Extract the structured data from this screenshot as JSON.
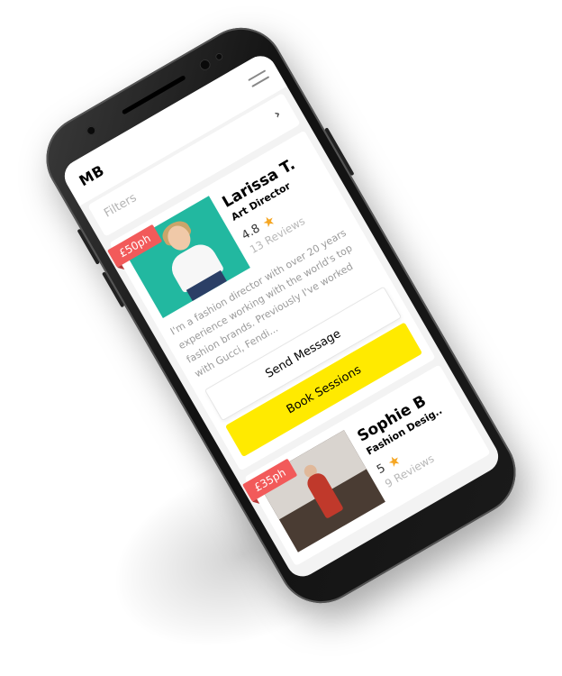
{
  "app": {
    "logo": "MB"
  },
  "filters": {
    "label": "Filters"
  },
  "cards": [
    {
      "price": "£50ph",
      "name": "Larissa T.",
      "role": "Art Director",
      "rating": "4.8",
      "reviews": "13 Reviews",
      "bio": "I'm a fashion director with over 20 years experience working with the world's top fashion brands. Previously I've worked with Gucci, Fendi...",
      "message_label": "Send Message",
      "book_label": "Book Sessions"
    },
    {
      "price": "£35ph",
      "name": "Sophie B",
      "role": "Fashion Desig..",
      "rating": "5",
      "reviews": "9 Reviews"
    }
  ],
  "colors": {
    "price_tag": "#f25a5a",
    "book_button": "#ffea00",
    "star": "#f5a623"
  },
  "icons": {
    "menu": "hamburger-icon",
    "chevron": "chevron-right-icon",
    "star": "star-icon"
  }
}
